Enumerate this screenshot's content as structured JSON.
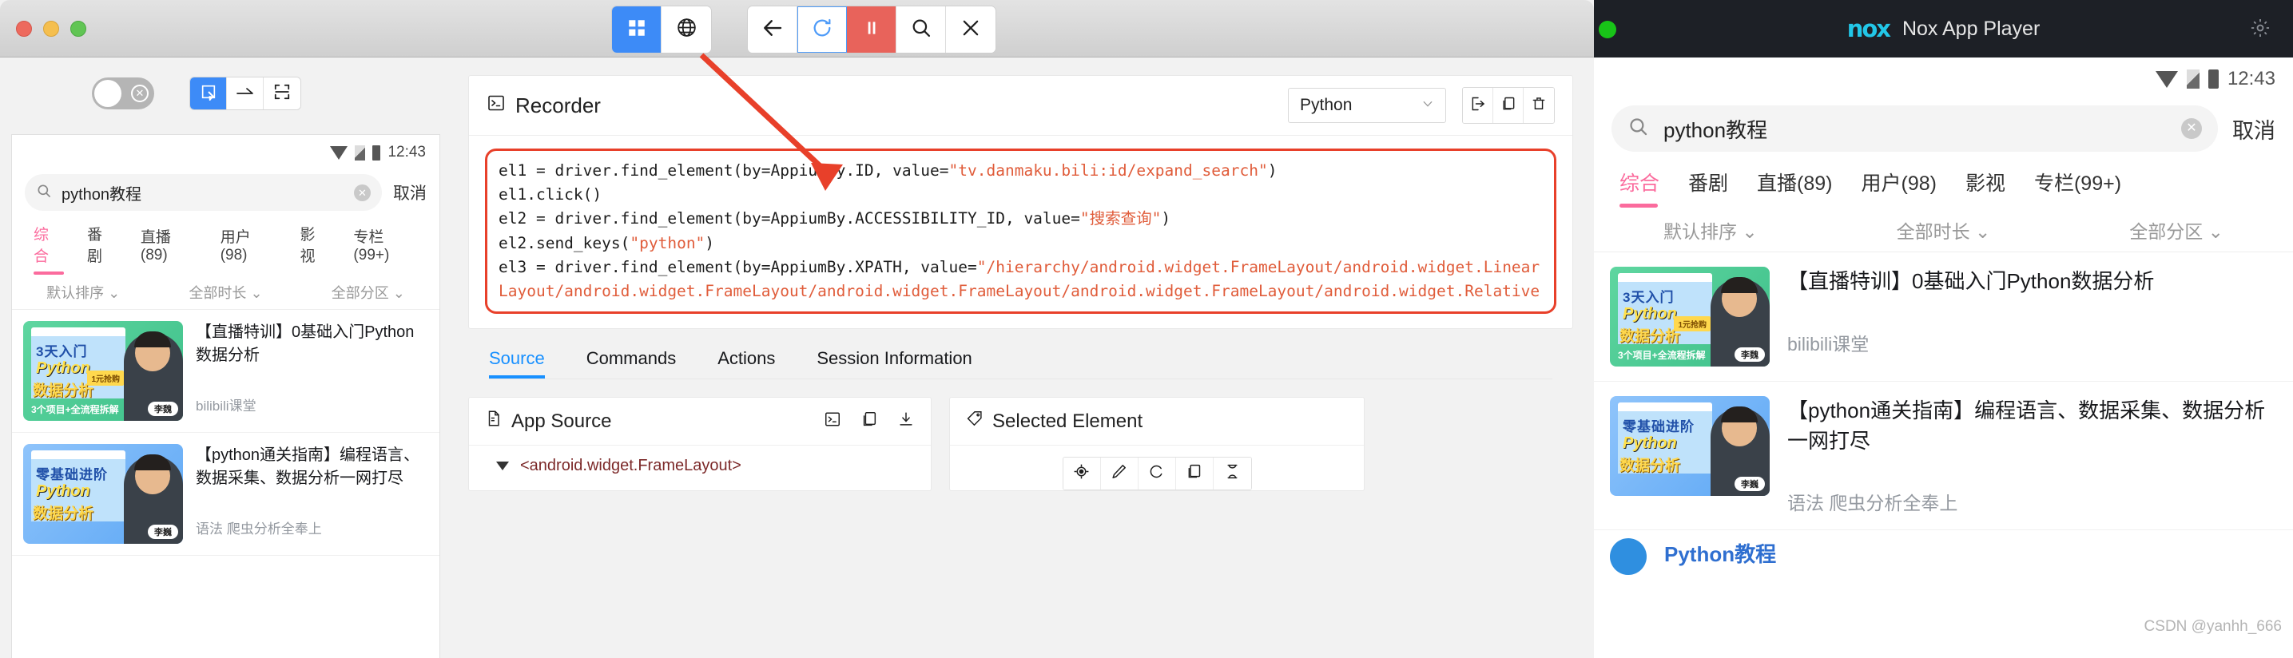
{
  "window": {
    "traffic_lights": [
      "close",
      "minimize",
      "maximize"
    ]
  },
  "toolbar": {
    "left_group": [
      {
        "name": "grid-view-button",
        "icon": "grid-icon",
        "active": true
      },
      {
        "name": "globe-view-button",
        "icon": "globe-icon",
        "active": false
      }
    ],
    "right_group": [
      {
        "name": "back-button",
        "icon": "arrow-left-icon"
      },
      {
        "name": "refresh-button",
        "icon": "refresh-icon"
      },
      {
        "name": "pause-button",
        "icon": "pause-icon"
      },
      {
        "name": "search-button",
        "icon": "search-icon"
      },
      {
        "name": "close-session-button",
        "icon": "close-icon"
      }
    ]
  },
  "mirror_controls": {
    "toggle_label": "toggle-off",
    "segments": [
      {
        "name": "select-element-mode",
        "icon": "select-icon",
        "active": true
      },
      {
        "name": "swipe-mode",
        "icon": "swipe-arrow-icon",
        "active": false
      },
      {
        "name": "tap-by-coordinates-mode",
        "icon": "crosshair-frame-icon",
        "active": false
      }
    ]
  },
  "device": {
    "status_bar": {
      "time": "12:43"
    },
    "search": {
      "value": "python教程",
      "cancel_label": "取消"
    },
    "categories": [
      {
        "label": "综合",
        "selected": true
      },
      {
        "label": "番剧",
        "selected": false
      },
      {
        "label": "直播(89)",
        "selected": false
      },
      {
        "label": "用户(98)",
        "selected": false
      },
      {
        "label": "影视",
        "selected": false
      },
      {
        "label": "专栏(99+)",
        "selected": false
      }
    ],
    "filters": [
      "默认排序",
      "全部时长",
      "全部分区"
    ],
    "results": [
      {
        "title": "【直播特训】0基础入门Python数据分析",
        "uploader": "bilibili课堂",
        "thumb": {
          "style": "green",
          "line1": "3天入门",
          "line2": "Python",
          "line3": "数据分析",
          "line4": "3个项目+全流程拆解",
          "badge": "1元抢购",
          "nametag": "李魏"
        }
      },
      {
        "title": "【python通关指南】编程语言、数据采集、数据分析一网打尽",
        "uploader": "语法 爬虫分析全奉上",
        "thumb": {
          "style": "blue",
          "line1": "零基础进阶",
          "line2": "Python",
          "line3": "数据分析",
          "line4": "",
          "badge": "",
          "nametag": "李巍"
        }
      }
    ]
  },
  "recorder": {
    "title": "Recorder",
    "title_icon": "terminal-icon",
    "language": "Python",
    "actions": [
      {
        "name": "show-boilerplate-button",
        "icon": "export-icon"
      },
      {
        "name": "copy-code-button",
        "icon": "copy-icon"
      },
      {
        "name": "clear-actions-button",
        "icon": "trash-icon"
      }
    ],
    "code_lines": [
      [
        {
          "t": "el1 = driver.find_element(by=AppiumBy.ID, value=",
          "s": false
        },
        {
          "t": "\"tv.danmaku.bili:id/expand_search\"",
          "s": true
        },
        {
          "t": ")",
          "s": false
        }
      ],
      [
        {
          "t": "el1.click()",
          "s": false
        }
      ],
      [
        {
          "t": "el2 = driver.find_element(by=AppiumBy.ACCESSIBILITY_ID, value=",
          "s": false
        },
        {
          "t": "\"搜索查询\"",
          "s": true
        },
        {
          "t": ")",
          "s": false
        }
      ],
      [
        {
          "t": "el2.send_keys(",
          "s": false
        },
        {
          "t": "\"python\"",
          "s": true
        },
        {
          "t": ")",
          "s": false
        }
      ],
      [
        {
          "t": "el3 = driver.find_element(by=AppiumBy.XPATH, value=",
          "s": false
        },
        {
          "t": "\"/hierarchy/android.widget.FrameLayout/android.widget.LinearLayout/android.widget.FrameLayout/android.widget.FrameLayout/android.widget.FrameLayout/android.widget.Relative",
          "s": true
        }
      ]
    ],
    "highlight_color": "#e8402a"
  },
  "tabs": [
    {
      "label": "Source",
      "active": true
    },
    {
      "label": "Commands",
      "active": false
    },
    {
      "label": "Actions",
      "active": false
    },
    {
      "label": "Session Information",
      "active": false
    }
  ],
  "app_source": {
    "title": "App Source",
    "title_icon": "document-icon",
    "actions": [
      {
        "name": "open-in-terminal-button",
        "icon": "terminal-icon"
      },
      {
        "name": "copy-source-button",
        "icon": "copy-icon"
      },
      {
        "name": "download-source-button",
        "icon": "download-icon"
      }
    ],
    "tree_root": "<android.widget.FrameLayout>"
  },
  "selected_element": {
    "title": "Selected Element",
    "title_icon": "tag-icon",
    "actions": [
      {
        "name": "tap-element-button",
        "icon": "crosshair-icon"
      },
      {
        "name": "send-keys-button",
        "icon": "pencil-icon"
      },
      {
        "name": "clear-element-button",
        "icon": "circle-icon"
      },
      {
        "name": "copy-attributes-button",
        "icon": "copy-icon"
      },
      {
        "name": "get-timing-button",
        "icon": "hourglass-icon"
      }
    ]
  },
  "nox": {
    "title": "Nox App Player",
    "logo": "nox",
    "settings_icon": "gear-icon",
    "status_bar": {
      "time": "12:43"
    },
    "search": {
      "value": "python教程",
      "cancel_label": "取消"
    },
    "categories": [
      {
        "label": "综合",
        "selected": true
      },
      {
        "label": "番剧",
        "selected": false
      },
      {
        "label": "直播(89)",
        "selected": false
      },
      {
        "label": "用户(98)",
        "selected": false
      },
      {
        "label": "影视",
        "selected": false
      },
      {
        "label": "专栏(99+)",
        "selected": false
      }
    ],
    "filters": [
      "默认排序",
      "全部时长",
      "全部分区"
    ],
    "results": [
      {
        "title": "【直播特训】0基础入门Python数据分析",
        "uploader": "bilibili课堂",
        "thumb": {
          "style": "green",
          "line1": "3天入门",
          "line2": "Python",
          "line3": "数据分析",
          "line4": "3个项目+全流程拆解",
          "badge": "1元抢购",
          "nametag": "李魏"
        }
      },
      {
        "title": "【python通关指南】编程语言、数据采集、数据分析一网打尽",
        "uploader": "语法 爬虫分析全奉上",
        "thumb": {
          "style": "blue",
          "line1": "零基础进阶",
          "line2": "Python",
          "line3": "数据分析",
          "line4": "",
          "badge": "",
          "nametag": "李巍"
        }
      }
    ],
    "watermark": "CSDN @yanhh_666",
    "partial_row": "Python教程"
  },
  "colors": {
    "accent_blue": "#1890ff",
    "toolbar_blue": "#3d8bf7",
    "pause_red": "#e8635b",
    "annotation_red": "#e8402a",
    "bili_pink": "#fb6b9d",
    "nox_cyan": "#22c7e8"
  }
}
